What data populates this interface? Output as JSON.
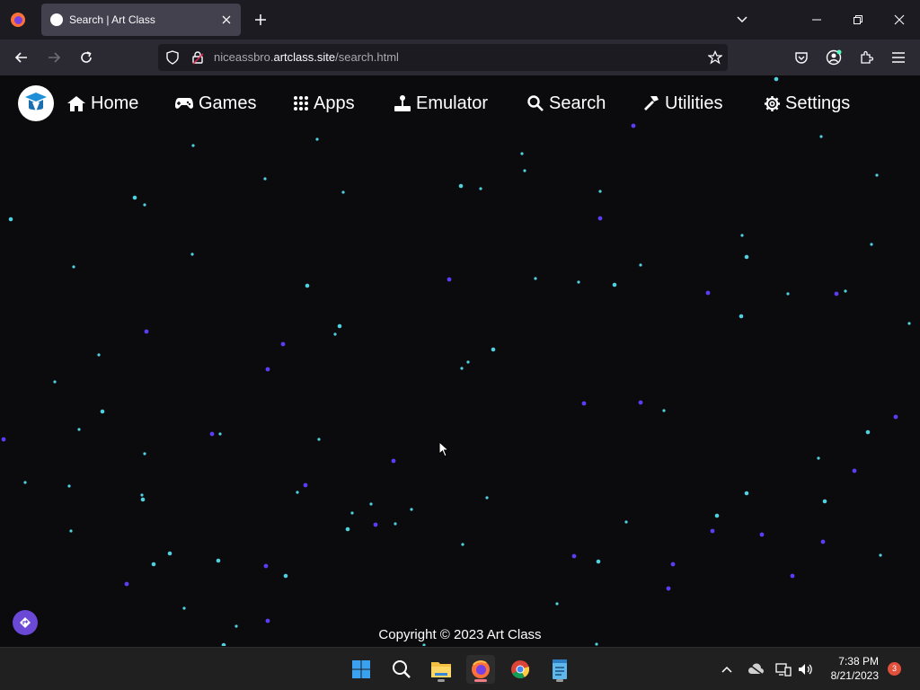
{
  "browser": {
    "tab_title": "Search | Art Class",
    "url_prefix": "niceassbro.",
    "url_domain": "artclass.site",
    "url_path": "/search.html"
  },
  "site": {
    "nav": [
      {
        "label": "Home",
        "icon": "home-icon"
      },
      {
        "label": "Games",
        "icon": "gamepad-icon"
      },
      {
        "label": "Apps",
        "icon": "grid-icon"
      },
      {
        "label": "Emulator",
        "icon": "joystick-icon"
      },
      {
        "label": "Search",
        "icon": "search-icon"
      },
      {
        "label": "Utilities",
        "icon": "hammer-icon"
      },
      {
        "label": "Settings",
        "icon": "gear-icon"
      }
    ],
    "footer": "Copyright © 2023 Art Class",
    "star_colors": [
      "#4fd1e0",
      "#5b3df5"
    ]
  },
  "taskbar": {
    "time": "7:38 PM",
    "date": "8/21/2023",
    "notification_count": "3"
  }
}
